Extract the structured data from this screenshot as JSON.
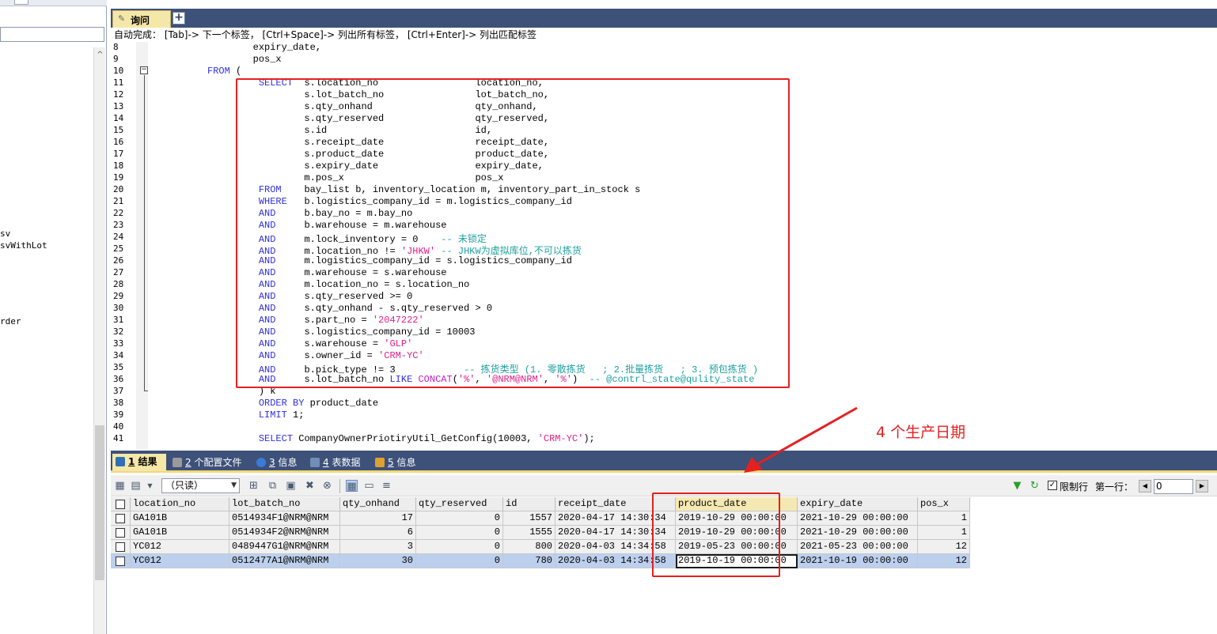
{
  "left_panel": {
    "items": [
      "sv",
      "svWithLot",
      "rder"
    ],
    "scroll_up_glyph": "^"
  },
  "editor": {
    "tab_label": "询问",
    "new_tab_glyph": "+",
    "hint": "自动完成： [Tab]-> 下一个标签， [Ctrl+Space]-> 列出所有标签， [Ctrl+Enter]-> 列出匹配标签"
  },
  "code": {
    "line_numbers": [
      "8",
      "9",
      "10",
      "11",
      "12",
      "13",
      "14",
      "15",
      "16",
      "17",
      "18",
      "19",
      "20",
      "21",
      "22",
      "23",
      "24",
      "25",
      "26",
      "27",
      "28",
      "29",
      "30",
      "31",
      "32",
      "33",
      "34",
      "35",
      "36",
      "37",
      "38",
      "39",
      "40",
      "41"
    ],
    "lines": [
      [
        {
          "t": "                  expiry_date,",
          "c": ""
        }
      ],
      [
        {
          "t": "                  pos_x",
          "c": ""
        }
      ],
      [
        {
          "t": "          ",
          "c": ""
        },
        {
          "t": "FROM",
          "c": "kw"
        },
        {
          "t": " (",
          "c": ""
        }
      ],
      [
        {
          "t": "                   ",
          "c": ""
        },
        {
          "t": "SELECT",
          "c": "kw"
        },
        {
          "t": "  s.location_no                 location_no,",
          "c": ""
        }
      ],
      [
        {
          "t": "                           s.lot_batch_no                lot_batch_no,",
          "c": ""
        }
      ],
      [
        {
          "t": "                           s.qty_onhand                  qty_onhand,",
          "c": ""
        }
      ],
      [
        {
          "t": "                           s.qty_reserved                qty_reserved,",
          "c": ""
        }
      ],
      [
        {
          "t": "                           s.id                          id,",
          "c": ""
        }
      ],
      [
        {
          "t": "                           s.receipt_date                receipt_date,",
          "c": ""
        }
      ],
      [
        {
          "t": "                           s.product_date                product_date,",
          "c": ""
        }
      ],
      [
        {
          "t": "                           s.expiry_date                 expiry_date,",
          "c": ""
        }
      ],
      [
        {
          "t": "                           m.pos_x                       pos_x",
          "c": ""
        }
      ],
      [
        {
          "t": "                   ",
          "c": ""
        },
        {
          "t": "FROM",
          "c": "kw"
        },
        {
          "t": "    bay_list b, inventory_location m, inventory_part_in_stock s",
          "c": ""
        }
      ],
      [
        {
          "t": "                   ",
          "c": ""
        },
        {
          "t": "WHERE",
          "c": "kw"
        },
        {
          "t": "   b.logistics_company_id = m.logistics_company_id",
          "c": ""
        }
      ],
      [
        {
          "t": "                   ",
          "c": ""
        },
        {
          "t": "AND",
          "c": "kw"
        },
        {
          "t": "     b.bay_no = m.bay_no",
          "c": ""
        }
      ],
      [
        {
          "t": "                   ",
          "c": ""
        },
        {
          "t": "AND",
          "c": "kw"
        },
        {
          "t": "     b.warehouse = m.warehouse",
          "c": ""
        }
      ],
      [
        {
          "t": "                   ",
          "c": ""
        },
        {
          "t": "AND",
          "c": "kw"
        },
        {
          "t": "     m.lock_inventory = 0    ",
          "c": ""
        },
        {
          "t": "-- 未锁定",
          "c": "cm"
        }
      ],
      [
        {
          "t": "                   ",
          "c": ""
        },
        {
          "t": "AND",
          "c": "kw"
        },
        {
          "t": "     m.location_no != ",
          "c": ""
        },
        {
          "t": "'JHKW'",
          "c": "str"
        },
        {
          "t": " ",
          "c": ""
        },
        {
          "t": "-- JHKW为虚拟库位,不可以拣货",
          "c": "cm"
        }
      ],
      [
        {
          "t": "                   ",
          "c": ""
        },
        {
          "t": "AND",
          "c": "kw"
        },
        {
          "t": "     m.logistics_company_id = s.logistics_company_id",
          "c": ""
        }
      ],
      [
        {
          "t": "                   ",
          "c": ""
        },
        {
          "t": "AND",
          "c": "kw"
        },
        {
          "t": "     m.warehouse = s.warehouse",
          "c": ""
        }
      ],
      [
        {
          "t": "                   ",
          "c": ""
        },
        {
          "t": "AND",
          "c": "kw"
        },
        {
          "t": "     m.location_no = s.location_no",
          "c": ""
        }
      ],
      [
        {
          "t": "                   ",
          "c": ""
        },
        {
          "t": "AND",
          "c": "kw"
        },
        {
          "t": "     s.qty_reserved >= 0",
          "c": ""
        }
      ],
      [
        {
          "t": "                   ",
          "c": ""
        },
        {
          "t": "AND",
          "c": "kw"
        },
        {
          "t": "     s.qty_onhand - s.qty_reserved > 0",
          "c": ""
        }
      ],
      [
        {
          "t": "                   ",
          "c": ""
        },
        {
          "t": "AND",
          "c": "kw"
        },
        {
          "t": "     s.part_no = ",
          "c": ""
        },
        {
          "t": "'2047222'",
          "c": "str"
        }
      ],
      [
        {
          "t": "                   ",
          "c": ""
        },
        {
          "t": "AND",
          "c": "kw"
        },
        {
          "t": "     s.logistics_company_id = 10003",
          "c": ""
        }
      ],
      [
        {
          "t": "                   ",
          "c": ""
        },
        {
          "t": "AND",
          "c": "kw"
        },
        {
          "t": "     s.warehouse = ",
          "c": ""
        },
        {
          "t": "'GLP'",
          "c": "str"
        }
      ],
      [
        {
          "t": "                   ",
          "c": ""
        },
        {
          "t": "AND",
          "c": "kw"
        },
        {
          "t": "     s.owner_id = ",
          "c": ""
        },
        {
          "t": "'CRM-YC'",
          "c": "str"
        }
      ],
      [
        {
          "t": "                   ",
          "c": ""
        },
        {
          "t": "AND",
          "c": "kw"
        },
        {
          "t": "     b.pick_type != 3            ",
          "c": ""
        },
        {
          "t": "-- 拣货类型 (1. 零散拣货   ; 2.批量拣货   ; 3. 预包拣货 )",
          "c": "cm"
        }
      ],
      [
        {
          "t": "                   ",
          "c": ""
        },
        {
          "t": "AND",
          "c": "kw"
        },
        {
          "t": "     s.lot_batch_no ",
          "c": ""
        },
        {
          "t": "LIKE",
          "c": "kw"
        },
        {
          "t": " ",
          "c": ""
        },
        {
          "t": "CONCAT",
          "c": "fn"
        },
        {
          "t": "(",
          "c": ""
        },
        {
          "t": "'%'",
          "c": "str"
        },
        {
          "t": ", ",
          "c": ""
        },
        {
          "t": "'@NRM@NRM'",
          "c": "str"
        },
        {
          "t": ", ",
          "c": ""
        },
        {
          "t": "'%'",
          "c": "str"
        },
        {
          "t": ")  ",
          "c": ""
        },
        {
          "t": "-- @contrl_state@qulity_state",
          "c": "cm"
        }
      ],
      [
        {
          "t": "                   ) k",
          "c": ""
        }
      ],
      [
        {
          "t": "                   ",
          "c": ""
        },
        {
          "t": "ORDER BY",
          "c": "kw"
        },
        {
          "t": " product_date",
          "c": ""
        }
      ],
      [
        {
          "t": "                   ",
          "c": ""
        },
        {
          "t": "LIMIT",
          "c": "kw"
        },
        {
          "t": " 1;",
          "c": ""
        }
      ],
      [
        {
          "t": "",
          "c": ""
        }
      ],
      [
        {
          "t": "                   ",
          "c": ""
        },
        {
          "t": "SELECT",
          "c": "kw"
        },
        {
          "t": " CompanyOwnerPriotiryUtil_GetConfig(10003, ",
          "c": ""
        },
        {
          "t": "'CRM-YC'",
          "c": "str"
        },
        {
          "t": ");",
          "c": ""
        }
      ]
    ]
  },
  "result_tabs": [
    {
      "num": "1",
      "label": "结果",
      "icon": "table-icon",
      "color": "#2f6fb6"
    },
    {
      "num": "2",
      "label": "个配置文件",
      "icon": "profile-icon",
      "color": "#9a9a9a"
    },
    {
      "num": "3",
      "label": "信息",
      "icon": "info-icon",
      "color": "#3a7bd5"
    },
    {
      "num": "4",
      "label": "表数据",
      "icon": "table-data-icon",
      "color": "#6f8fb8"
    },
    {
      "num": "5",
      "label": "信息",
      "icon": "info-icon",
      "color": "#e0a030"
    }
  ],
  "toolbar": {
    "mode": "（只读）",
    "limit_label": "限制行",
    "first_row_label": "第一行：",
    "first_row_value": "0"
  },
  "grid": {
    "columns": [
      "location_no",
      "lot_batch_no",
      "qty_onhand",
      "qty_reserved",
      "id",
      "receipt_date",
      "product_date",
      "expiry_date",
      "pos_x"
    ],
    "rows": [
      [
        "GA101B",
        "0514934F1@NRM@NRM",
        "17",
        "0",
        "1557",
        "2020-04-17 14:30:34",
        "2019-10-29 00:00:00",
        "2021-10-29 00:00:00",
        "1"
      ],
      [
        "GA101B",
        "0514934F2@NRM@NRM",
        "6",
        "0",
        "1555",
        "2020-04-17 14:30:34",
        "2019-10-29 00:00:00",
        "2021-10-29 00:00:00",
        "1"
      ],
      [
        "YC012",
        "0489447G1@NRM@NRM",
        "3",
        "0",
        "800",
        "2020-04-03 14:34:58",
        "2019-05-23 00:00:00",
        "2021-05-23 00:00:00",
        "12"
      ],
      [
        "YC012",
        "0512477A1@NRM@NRM",
        "30",
        "0",
        "780",
        "2020-04-03 14:34:58",
        "2019-10-19 00:00:00",
        "2021-10-19 00:00:00",
        "12"
      ]
    ]
  },
  "annotation": "4 个生产日期",
  "colors": {
    "annotation": "#e52020",
    "tab_bar": "#3d5179",
    "active_tab": "#f5e7a8"
  }
}
